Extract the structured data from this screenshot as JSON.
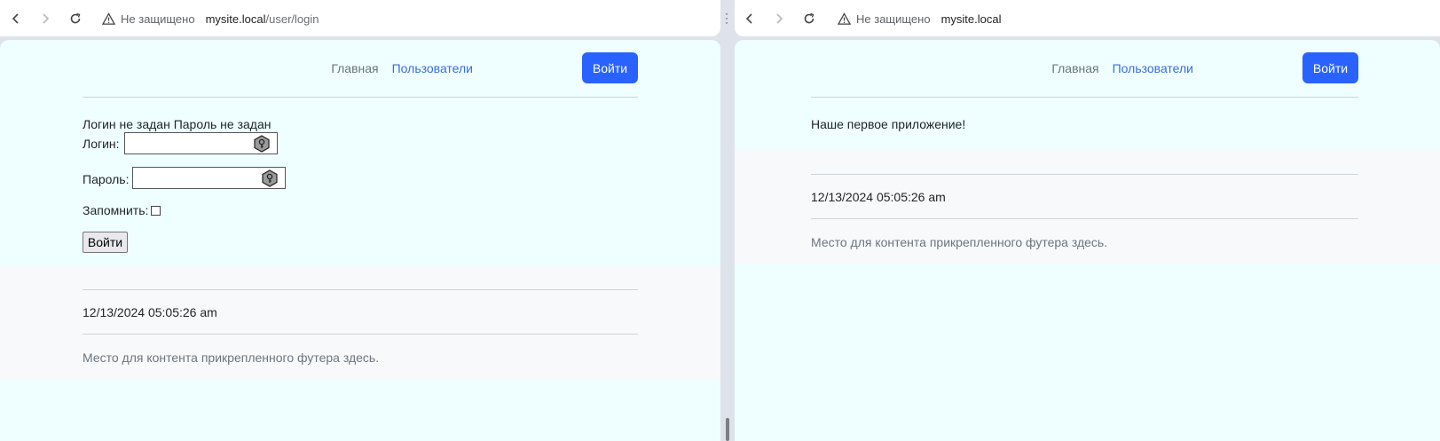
{
  "left": {
    "address": {
      "security_label": "Не защищено",
      "host": "mysite.local",
      "path": "/user/login"
    },
    "nav": {
      "home": "Главная",
      "users": "Пользователи",
      "login_button": "Войти"
    },
    "form": {
      "errors": "Логин не задан Пароль не задан",
      "login_label": "Логин:",
      "password_label": "Пароль:",
      "remember_label": "Запомнить:",
      "submit": "Войти"
    },
    "footer": {
      "date": "12/13/2024 05:05:26 am",
      "note": "Место для контента прикрепленного футера здесь."
    }
  },
  "right": {
    "address": {
      "security_label": "Не защищено",
      "host": "mysite.local",
      "path": ""
    },
    "nav": {
      "home": "Главная",
      "users": "Пользователи",
      "login_button": "Войти"
    },
    "main_text": "Наше первое приложение!",
    "footer": {
      "date": "12/13/2024 05:05:26 am",
      "note": "Место для контента прикрепленного футера здесь."
    }
  },
  "icons": {
    "back": "arrow-left-icon",
    "forward": "arrow-right-icon",
    "reload": "reload-icon",
    "warning": "warning-triangle-icon",
    "key": "key-icon",
    "split_menu": "vertical-dots-icon"
  },
  "colors": {
    "page_bg": "#efffff",
    "footer_bg": "#f8f9fa",
    "primary": "#2962ff",
    "link": "#3a6dde"
  }
}
